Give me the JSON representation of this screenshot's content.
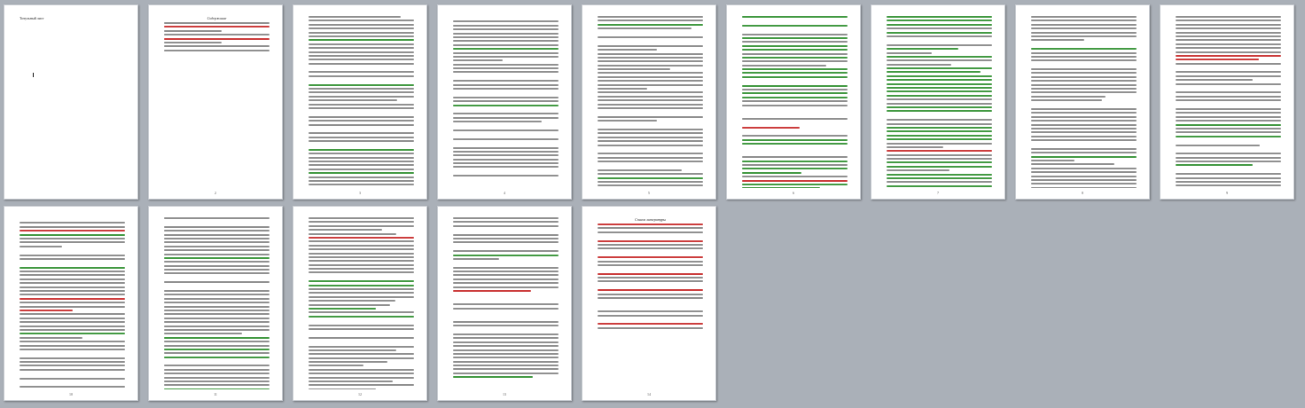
{
  "document": {
    "title_page_label": "Титульный лист",
    "contents_heading": "Содержание",
    "references_heading": "Список литературы"
  },
  "colors": {
    "text": "#7c7c7c",
    "highlight": "#2f8f2f",
    "mark": "#c62828",
    "background": "#aab0b8",
    "page": "#ffffff"
  },
  "pages": [
    {
      "id": 1,
      "kind": "title",
      "label_key": "title_page_label",
      "number": ""
    },
    {
      "id": 2,
      "kind": "contents",
      "label_key": "contents_heading",
      "number": "2"
    },
    {
      "id": 3,
      "kind": "text",
      "number": "3"
    },
    {
      "id": 4,
      "kind": "text",
      "number": "4"
    },
    {
      "id": 5,
      "kind": "text",
      "number": "5"
    },
    {
      "id": 6,
      "kind": "text",
      "number": "6"
    },
    {
      "id": 7,
      "kind": "text",
      "number": "7"
    },
    {
      "id": 8,
      "kind": "text",
      "number": "8"
    },
    {
      "id": 9,
      "kind": "text",
      "number": "9"
    },
    {
      "id": 10,
      "kind": "text",
      "number": "10"
    },
    {
      "id": 11,
      "kind": "text",
      "number": "11"
    },
    {
      "id": 12,
      "kind": "text",
      "number": "12"
    },
    {
      "id": 13,
      "kind": "text",
      "number": "13"
    },
    {
      "id": 14,
      "kind": "references",
      "label_key": "references_heading",
      "number": "14"
    }
  ]
}
